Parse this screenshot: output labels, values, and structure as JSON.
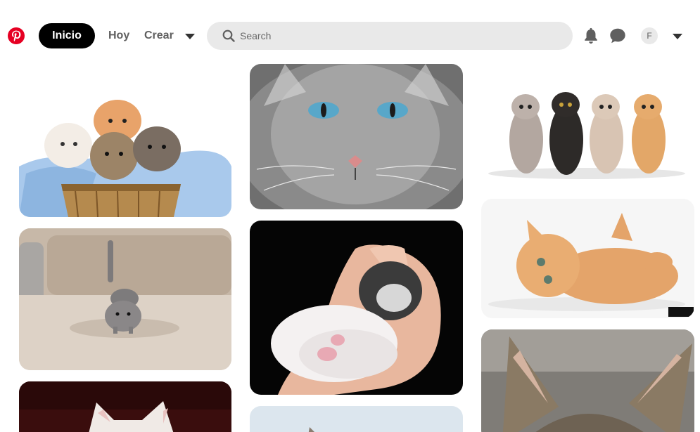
{
  "header": {
    "logo_icon": "pinterest-logo-icon",
    "brand_color": "#e60023",
    "home_label": "Inicio",
    "today_label": "Hoy",
    "create_label": "Crear",
    "search_placeholder": "Search",
    "notifications_icon": "bell-icon",
    "messages_icon": "chat-bubble-icon",
    "avatar_initial": "F",
    "account_menu_icon": "chevron-down-icon"
  },
  "feed": {
    "pins": [
      {
        "column": 1,
        "subject": "kittens in basket"
      },
      {
        "column": 1,
        "subject": "grey kitten walking"
      },
      {
        "column": 1,
        "subject": "white kitten"
      },
      {
        "column": 2,
        "subject": "grey cat blue eyes"
      },
      {
        "column": 2,
        "subject": "newborn kitten in hand"
      },
      {
        "column": 2,
        "subject": "kitten"
      },
      {
        "column": 3,
        "subject": "four kittens sitting"
      },
      {
        "column": 3,
        "subject": "orange kitten playing"
      },
      {
        "column": 3,
        "subject": "tabby kitten"
      }
    ]
  }
}
